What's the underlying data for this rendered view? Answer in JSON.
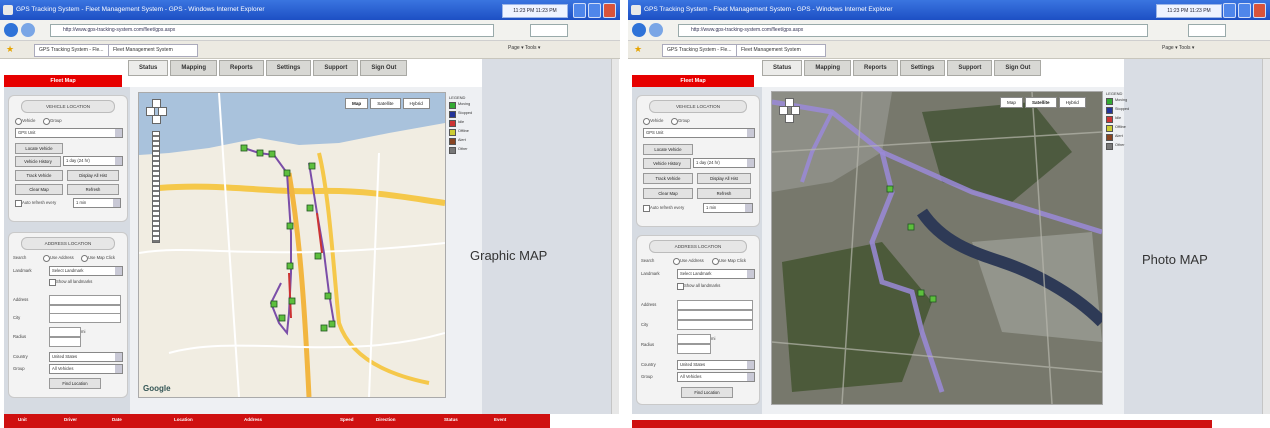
{
  "screens": [
    {
      "window": {
        "title": "GPS Tracking System - Fleet Management System - GPS - Windows Internet Explorer",
        "address": "http://www.gps-tracking-system.com/fleet/gps.aspx",
        "favorite_tab": "GPS Tracking System - Fle...",
        "second_tab": "Fleet Management System",
        "clock": "11:23 PM  11:23 PM",
        "toolbar": "Page ▾  Tools ▾"
      },
      "app": {
        "menu": [
          "Status",
          "Mapping",
          "Reports",
          "Settings",
          "Support",
          "Sign Out"
        ],
        "active_menu": "Status",
        "banner": "Fleet Map"
      },
      "vehicle_panel": {
        "header": "VEHICLE LOCATION",
        "radio_a": "Vehicle",
        "radio_b": "Group",
        "select_value": "GPS Unit",
        "buttons": {
          "locate": "Locate Vehicle",
          "history": "Vehicle History",
          "history_value": "1 day (24 hr)",
          "track": "Track Vehicle",
          "history_all": "Display All Hist",
          "clear": "Clear Map",
          "refresh": "Refresh"
        },
        "auto_refresh": "Auto refresh every",
        "auto_value": "1 min"
      },
      "address_panel": {
        "header": "ADDRESS LOCATION",
        "search_by_label": "Search",
        "radio_a": "Use Address",
        "radio_b": "Use Map Click",
        "landmark_label": "Landmark",
        "landmark_value": "Select Landmark",
        "show_all": "Show all landmarks",
        "address_label": "Address",
        "city_label": "City",
        "radius_label": "Radius",
        "radius_unit": "mi",
        "country_label": "Country",
        "country_value": "United States",
        "group_label": "Group",
        "group_value": "All Vehicles",
        "find_button": "Find Location"
      },
      "map": {
        "type_buttons": [
          "Map",
          "Satellite",
          "Hybrid"
        ],
        "selected": "Map",
        "logo": "Google"
      },
      "legend": {
        "title": "LEGEND",
        "items": [
          {
            "label": "Moving",
            "color": "#33aa33"
          },
          {
            "label": "Stopped",
            "color": "#223399"
          },
          {
            "label": "Idle",
            "color": "#cc3333"
          },
          {
            "label": "Offline",
            "color": "#cccc33"
          },
          {
            "label": "Alert",
            "color": "#884422"
          },
          {
            "label": "Other",
            "color": "#777777"
          }
        ]
      },
      "caption": "Graphic MAP",
      "table_headers": [
        "Unit",
        "Driver",
        "Date",
        "Location",
        "Address",
        "Speed",
        "Direction",
        "Status",
        "Event"
      ]
    },
    {
      "window": {
        "title": "GPS Tracking System - Fleet Management System - GPS - Windows Internet Explorer",
        "address": "http://www.gps-tracking-system.com/fleet/gps.aspx",
        "favorite_tab": "GPS Tracking System - Fle...",
        "second_tab": "Fleet Management System",
        "clock": "11:23 PM  11:23 PM",
        "toolbar": "Page ▾  Tools ▾"
      },
      "app": {
        "menu": [
          "Status",
          "Mapping",
          "Reports",
          "Settings",
          "Support",
          "Sign Out"
        ],
        "active_menu": "Status",
        "banner": "Fleet Map"
      },
      "vehicle_panel": {
        "header": "VEHICLE LOCATION",
        "radio_a": "Vehicle",
        "radio_b": "Group",
        "select_value": "GPS Unit",
        "buttons": {
          "locate": "Locate Vehicle",
          "history": "Vehicle History",
          "history_value": "1 day (24 hr)",
          "track": "Track Vehicle",
          "history_all": "Display All Hist",
          "clear": "Clear Map",
          "refresh": "Refresh"
        },
        "auto_refresh": "Auto refresh every",
        "auto_value": "1 min"
      },
      "address_panel": {
        "header": "ADDRESS LOCATION",
        "search_by_label": "Search",
        "radio_a": "Use Address",
        "radio_b": "Use Map Click",
        "landmark_label": "Landmark",
        "landmark_value": "Select Landmark",
        "show_all": "Show all landmarks",
        "address_label": "Address",
        "city_label": "City",
        "radius_label": "Radius",
        "radius_unit": "mi",
        "country_label": "Country",
        "country_value": "United States",
        "group_label": "Group",
        "group_value": "All Vehicles",
        "find_button": "Find Location"
      },
      "map": {
        "type_buttons": [
          "Map",
          "Satellite",
          "Hybrid"
        ],
        "selected": "Satellite",
        "logo": ""
      },
      "legend": {
        "title": "LEGEND",
        "items": [
          {
            "label": "Moving",
            "color": "#33aa33"
          },
          {
            "label": "Stopped",
            "color": "#223399"
          },
          {
            "label": "Idle",
            "color": "#cc3333"
          },
          {
            "label": "Offline",
            "color": "#cccc33"
          },
          {
            "label": "Alert",
            "color": "#884422"
          },
          {
            "label": "Other",
            "color": "#777777"
          }
        ]
      },
      "caption": "Photo MAP",
      "table_headers": []
    }
  ]
}
